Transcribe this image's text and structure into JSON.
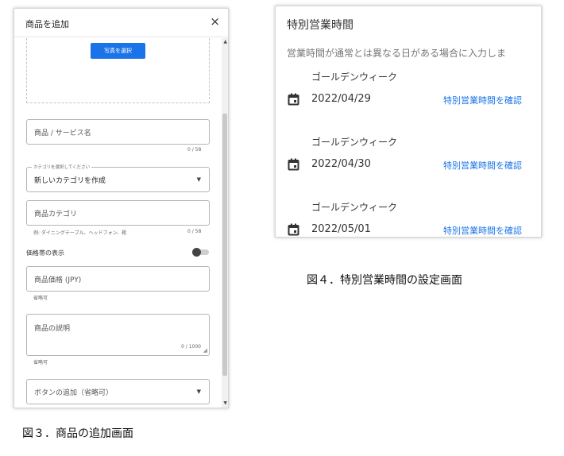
{
  "left_panel": {
    "title": "商品を追加",
    "close_glyph": "×",
    "photo_button": "写真を選択",
    "name_field": {
      "placeholder": "商品 / サービス名",
      "counter": "0 / 58"
    },
    "category_select": {
      "legend": "カテゴリを選択してください",
      "value": "新しいカテゴリを作成"
    },
    "product_category": {
      "placeholder": "商品カテゴリ",
      "example": "例: ダイニングテーブル、ヘッドフォン、靴",
      "counter": "0 / 58"
    },
    "price_range_label": "価格帯の表示",
    "price_field": {
      "placeholder": "商品価格 (JPY)",
      "note": "省略可"
    },
    "description_field": {
      "placeholder": "商品の説明",
      "counter": "0 / 1000",
      "note": "省略可"
    },
    "button_select": {
      "placeholder": "ボタンの追加（省略可）"
    }
  },
  "right_panel": {
    "title": "特別営業時間",
    "description": "営業時間が通常とは異なる日がある場合に入力しま",
    "entries": [
      {
        "name": "ゴールデンウィーク",
        "date": "2022/04/29",
        "link": "特別営業時間を確認"
      },
      {
        "name": "ゴールデンウィーク",
        "date": "2022/04/30",
        "link": "特別営業時間を確認"
      },
      {
        "name": "ゴールデンウィーク",
        "date": "2022/05/01",
        "link": "特別営業時間を確認"
      }
    ]
  },
  "captions": {
    "fig3": "図３．商品の追加画面",
    "fig4": "図４．特別営業時間の設定画面"
  },
  "colors": {
    "accent": "#1a73e8",
    "icon": "#333333"
  }
}
